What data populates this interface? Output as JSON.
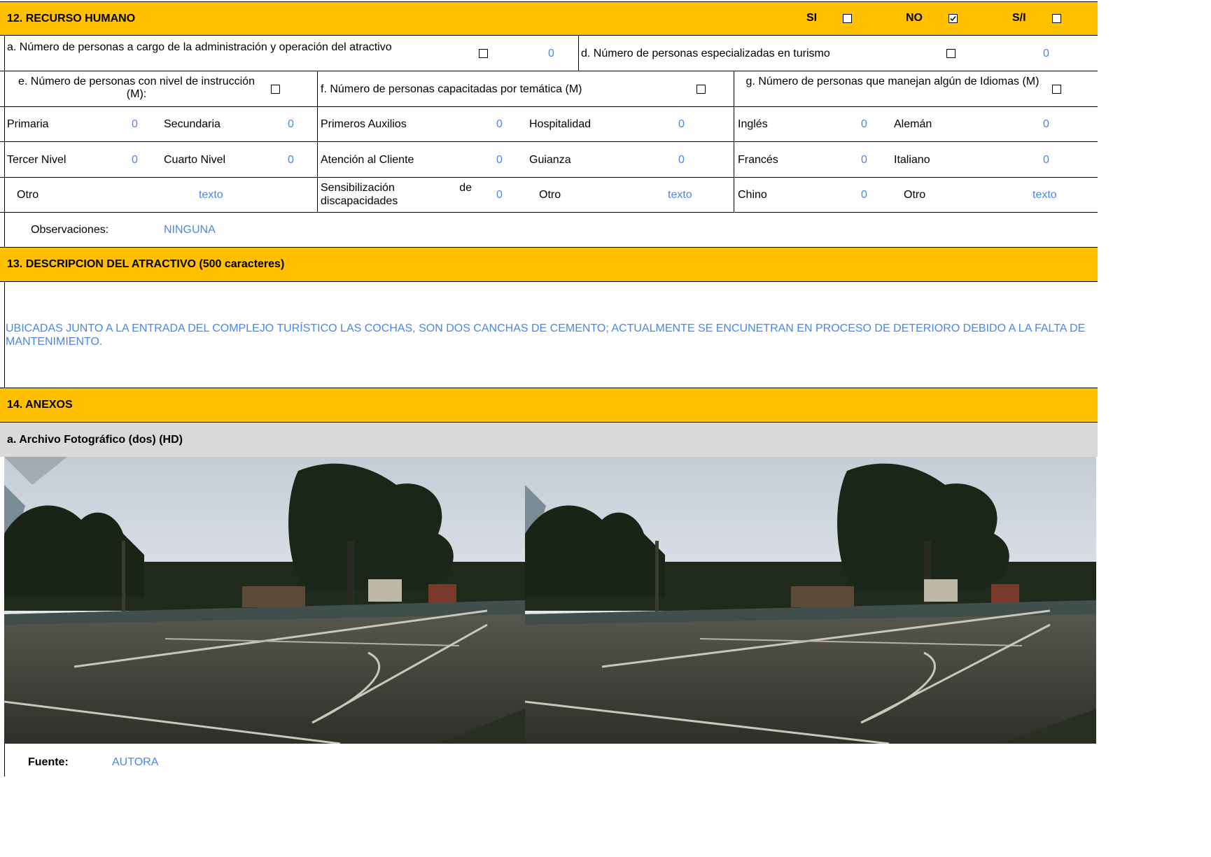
{
  "sec12": {
    "title": "12. RECURSO HUMANO",
    "si_label": "SI",
    "no_label": "NO",
    "si_label2": "S/I",
    "si_checked": false,
    "no_checked": true,
    "sin_info_checked": false
  },
  "row_a": {
    "a_label": "a. Número de personas a cargo de la administración y operación del atractivo",
    "a_value": "0",
    "d_label": "d. Número de personas especializadas en turismo",
    "d_value": "0"
  },
  "row_efg": {
    "e_label": "e. Número de personas con nivel de instrucción (M):",
    "f_label": "f. Número de personas capacitadas por temática (M)",
    "g_label": "g. Número de personas que manejan algún de Idiomas (M)"
  },
  "education": [
    {
      "label": "Primaria",
      "value": "0"
    },
    {
      "label": "Secundaria",
      "value": "0"
    },
    {
      "label": "Tercer Nivel",
      "value": "0"
    },
    {
      "label": "Cuarto Nivel",
      "value": "0"
    },
    {
      "label": "Otro",
      "value": "texto"
    }
  ],
  "training": [
    {
      "label": "Primeros Auxilios",
      "value": "0"
    },
    {
      "label": "Hospitalidad",
      "value": "0"
    },
    {
      "label": "Atención al Cliente",
      "value": "0"
    },
    {
      "label": "Guianza",
      "value": "0"
    },
    {
      "label": "Sensibilización de discapacidades",
      "value": "0"
    },
    {
      "label": "Otro",
      "value": "texto"
    }
  ],
  "languages": [
    {
      "label": "Inglés",
      "value": "0"
    },
    {
      "label": "Alemán",
      "value": "0"
    },
    {
      "label": "Francés",
      "value": "0"
    },
    {
      "label": "Italiano",
      "value": "0"
    },
    {
      "label": "Chino",
      "value": "0"
    },
    {
      "label": "Otro",
      "value": "texto"
    }
  ],
  "observaciones": {
    "label": "Observaciones:",
    "value": "NINGUNA"
  },
  "sec13": {
    "title": "13. DESCRIPCION DEL ATRACTIVO (500 caracteres)",
    "text": "UBICADAS JUNTO A LA ENTRADA DEL COMPLEJO TURÍSTICO LAS COCHAS, SON DOS CANCHAS DE CEMENTO; ACTUALMENTE SE ENCUNETRAN EN PROCESO DE DETERIORO DEBIDO A LA FALTA DE MANTENIMIENTO."
  },
  "sec14": {
    "title": "14. ANEXOS",
    "subtitle": "a. Archivo Fotográfico (dos) (HD)"
  },
  "fuente": {
    "label": "Fuente:",
    "value": "AUTORA"
  },
  "colors": {
    "header": "#FFC000",
    "value_text": "#4A86E8",
    "subheader": "#D9D9D9"
  }
}
